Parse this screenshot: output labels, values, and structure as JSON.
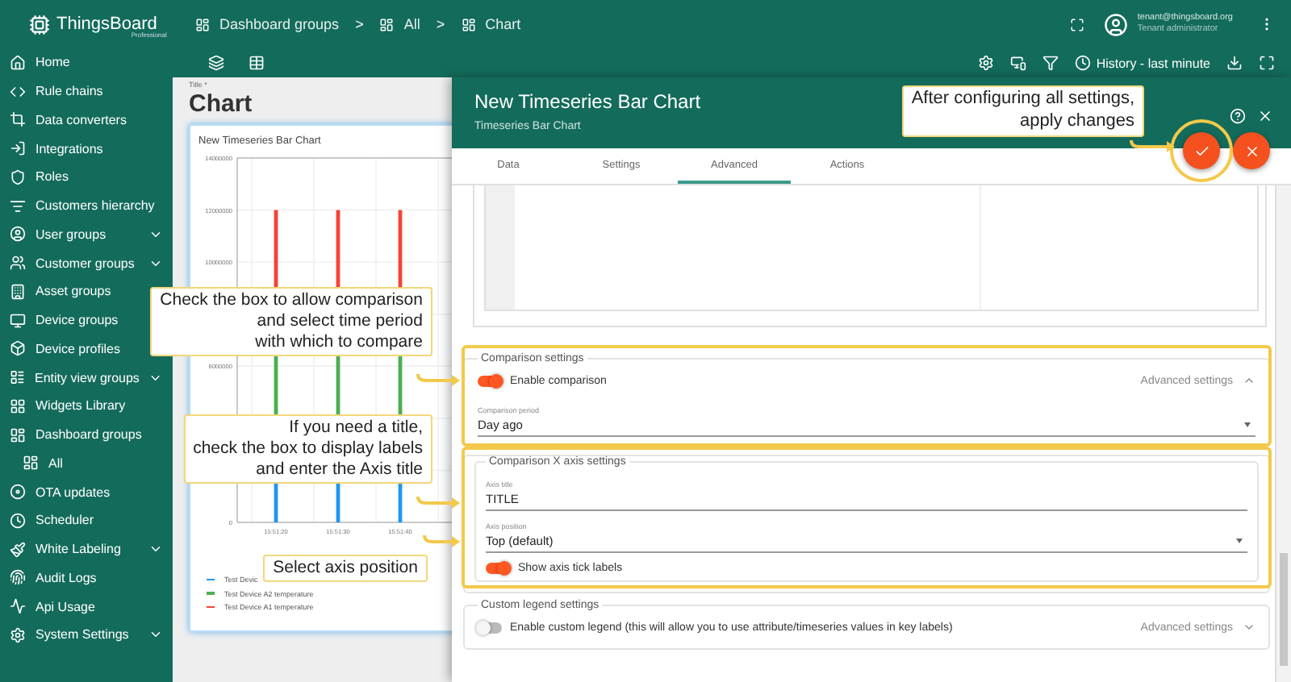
{
  "brand": {
    "name": "ThingsBoard",
    "edition": "Professional"
  },
  "sidebar": {
    "items": [
      {
        "label": "Home",
        "has_submenu": false
      },
      {
        "label": "Rule chains",
        "has_submenu": false
      },
      {
        "label": "Data converters",
        "has_submenu": false
      },
      {
        "label": "Integrations",
        "has_submenu": false
      },
      {
        "label": "Roles",
        "has_submenu": false
      },
      {
        "label": "Customers hierarchy",
        "has_submenu": false
      },
      {
        "label": "User groups",
        "has_submenu": true
      },
      {
        "label": "Customer groups",
        "has_submenu": true
      },
      {
        "label": "Asset groups",
        "has_submenu": false
      },
      {
        "label": "Device groups",
        "has_submenu": false
      },
      {
        "label": "Device profiles",
        "has_submenu": false
      },
      {
        "label": "Entity view groups",
        "has_submenu": true
      },
      {
        "label": "Widgets Library",
        "has_submenu": false
      },
      {
        "label": "Dashboard groups",
        "has_submenu": false,
        "children": [
          {
            "label": "All",
            "has_submenu": false
          }
        ]
      },
      {
        "label": "OTA updates",
        "has_submenu": false
      },
      {
        "label": "Scheduler",
        "has_submenu": false
      },
      {
        "label": "White Labeling",
        "has_submenu": true
      },
      {
        "label": "Audit Logs",
        "has_submenu": false
      },
      {
        "label": "Api Usage",
        "has_submenu": false
      },
      {
        "label": "System Settings",
        "has_submenu": true
      }
    ]
  },
  "breadcrumb": {
    "items": [
      "Dashboard groups",
      "All",
      "Chart"
    ],
    "separator": ">"
  },
  "user": {
    "email": "tenant@thingsboard.org",
    "role": "Tenant administrator"
  },
  "toolbar": {
    "timewindow": "History - last minute"
  },
  "dashboard": {
    "title_label": "Title *",
    "title": "Chart",
    "widget": {
      "title": "New Timeseries Bar Chart",
      "y_axis_labels": [
        "14000000",
        "12000000",
        "10000000",
        "6000000",
        "0"
      ],
      "x_axis_labels": [
        "15:51:20",
        "15:51:30",
        "15:51:40"
      ],
      "legend": [
        {
          "label": "Test Devic",
          "color": "#2196f3"
        },
        {
          "label": "Test Device A2 temperature",
          "color": "#4caf50"
        },
        {
          "label": "Test Device A1 temperature",
          "color": "#f44336"
        }
      ]
    }
  },
  "dialog": {
    "title": "New Timeseries Bar Chart",
    "subtitle": "Timeseries Bar Chart",
    "tabs": [
      {
        "label": "Data",
        "selected": false
      },
      {
        "label": "Settings",
        "selected": false
      },
      {
        "label": "Advanced",
        "selected": true
      },
      {
        "label": "Actions",
        "selected": false
      }
    ],
    "comparison": {
      "legend": "Comparison settings",
      "toggle": {
        "label": "Enable comparison",
        "on": true
      },
      "advanced": {
        "label": "Advanced settings",
        "expanded": true
      },
      "period": {
        "label": "Comparison period",
        "value": "Day ago"
      }
    },
    "x_axis": {
      "legend": "Comparison X axis settings",
      "title": {
        "label": "Axis title",
        "value": "TITLE"
      },
      "position": {
        "label": "Axis position",
        "value": "Top (default)"
      },
      "toggle": {
        "label": "Show axis tick labels",
        "on": true
      }
    },
    "custom_legend": {
      "legend": "Custom legend settings",
      "toggle": {
        "label": "Enable custom legend (this will allow you to use attribute/timeseries values in key labels)",
        "on": false
      },
      "advanced": {
        "label": "Advanced settings",
        "expanded": false
      }
    }
  },
  "callouts": [
    {
      "text": "After configuring all settings,\napply changes"
    },
    {
      "text": "Check the box to allow comparison\nand select time period\nwith which to compare"
    },
    {
      "text": "If you need a title,\ncheck the box to display labels\nand enter the Axis title"
    },
    {
      "text": "Select axis position"
    }
  ]
}
